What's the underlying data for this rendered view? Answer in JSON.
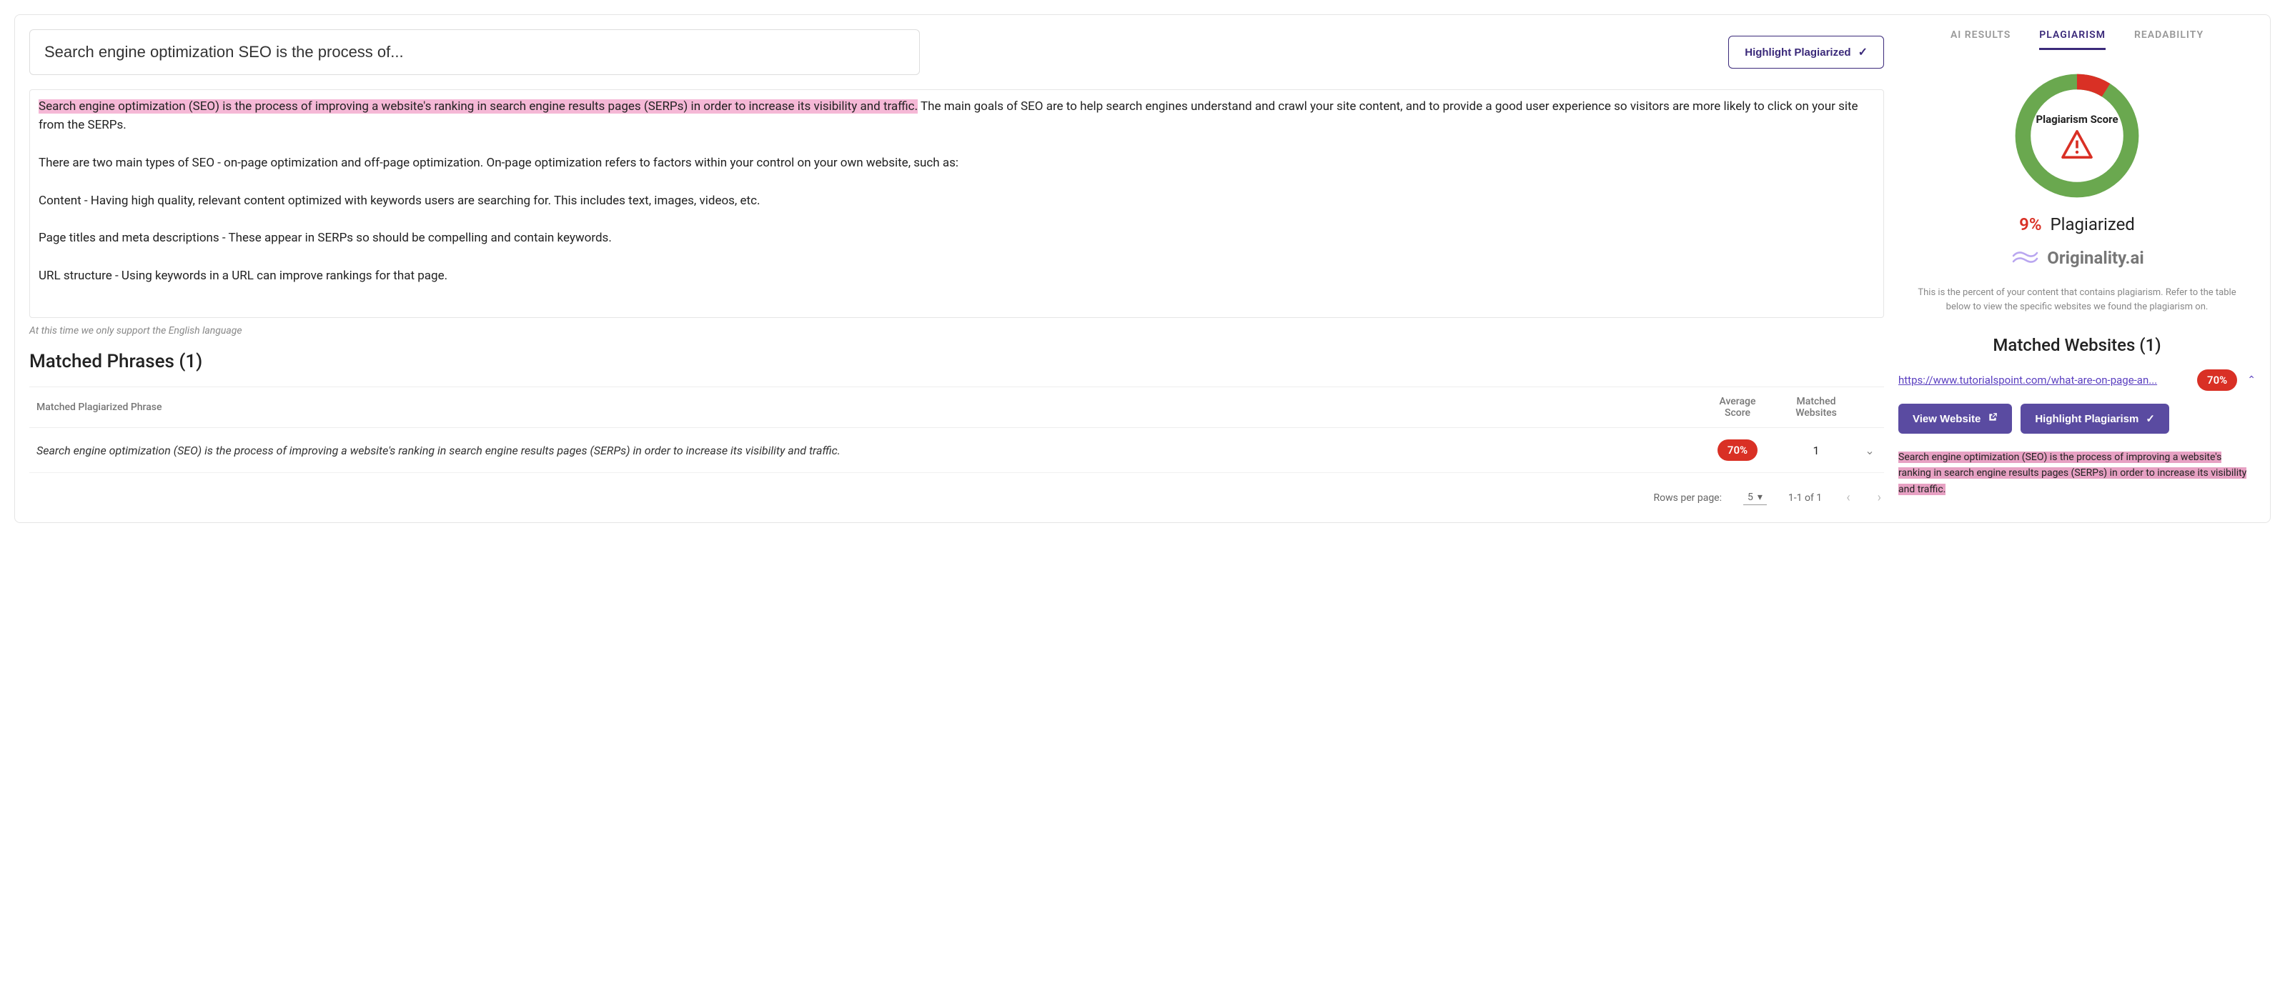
{
  "title_input": "Search engine optimization SEO is the process of...",
  "highlight_btn": "Highlight Plagiarized",
  "content": {
    "highlighted": "Search engine optimization (SEO) is the process of improving a website's ranking in search engine results pages (SERPs) in order to increase its visibility and traffic.",
    "p1_rest": " The main goals of SEO are to help search engines understand and crawl your site content, and to provide a good user experience so visitors are more likely to click on your site from the SERPs.",
    "p2": "There are two main types of SEO - on-page optimization and off-page optimization. On-page optimization refers to factors within your control on your own website, such as:",
    "p3": "Content - Having high quality, relevant content optimized with keywords users are searching for. This includes text, images, videos, etc.",
    "p4": "Page titles and meta descriptions - These appear in SERPs so should be compelling and contain keywords.",
    "p5": "URL structure - Using keywords in a URL can improve rankings for that page."
  },
  "lang_note": "At this time we only support the English language",
  "matched_phrases_title": "Matched Phrases (1)",
  "table": {
    "col_phrase": "Matched Plagiarized Phrase",
    "col_avg_score": "Average Score",
    "col_matched_sites": "Matched Websites",
    "row1": {
      "phrase": "Search engine optimization (SEO) is the process of improving a website's ranking in search engine results pages (SERPs) in order to increase its visibility and traffic.",
      "score": "70%",
      "sites": "1"
    }
  },
  "pager": {
    "rpp_label": "Rows per page:",
    "rpp_value": "5",
    "range": "1-1 of 1"
  },
  "tabs": {
    "ai": "AI RESULTS",
    "plag": "PLAGIARISM",
    "read": "READABILITY"
  },
  "donut": {
    "label": "Plagiarism Score",
    "percent": 9,
    "percent_str": "9%",
    "word": "Plagiarized",
    "green": "#6aa84f",
    "red": "#d93025"
  },
  "brand": "Originality.ai",
  "helper_text": "This is the percent of your content that contains plagiarism. Refer to the table below to view the specific websites we found the plagiarism on.",
  "matched_sites_title": "Matched Websites (1)",
  "site": {
    "url": "https://www.tutorialspoint.com/what-are-on-page-an...",
    "score": "70%"
  },
  "view_site_btn": "View Website",
  "highlight_plag_btn": "Highlight Plagiarism",
  "excerpt": "Search engine optimization (SEO) is the process of improving a website's ranking in search engine results pages (SERPs) in order to increase its visibility and traffic."
}
